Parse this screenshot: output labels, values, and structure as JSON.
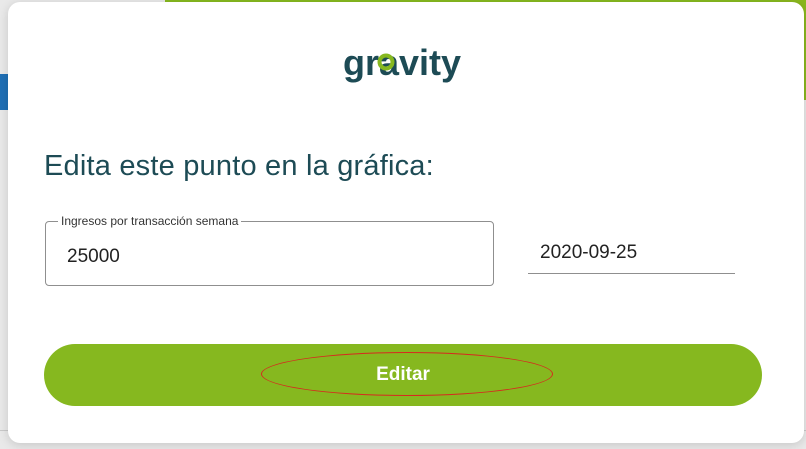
{
  "dialog": {
    "brand": "gravity",
    "brand_colors": {
      "text": "#1d4b55",
      "accent": "#86b81f"
    },
    "title": "Edita este punto en la gráfica:",
    "value_field": {
      "label": "Ingresos por transacción semana",
      "value": "25000"
    },
    "date_field": {
      "value": "2020-09-25"
    },
    "submit_label": "Editar",
    "accent_color": "#86b81f",
    "highlight_color": "#d62a1f"
  }
}
